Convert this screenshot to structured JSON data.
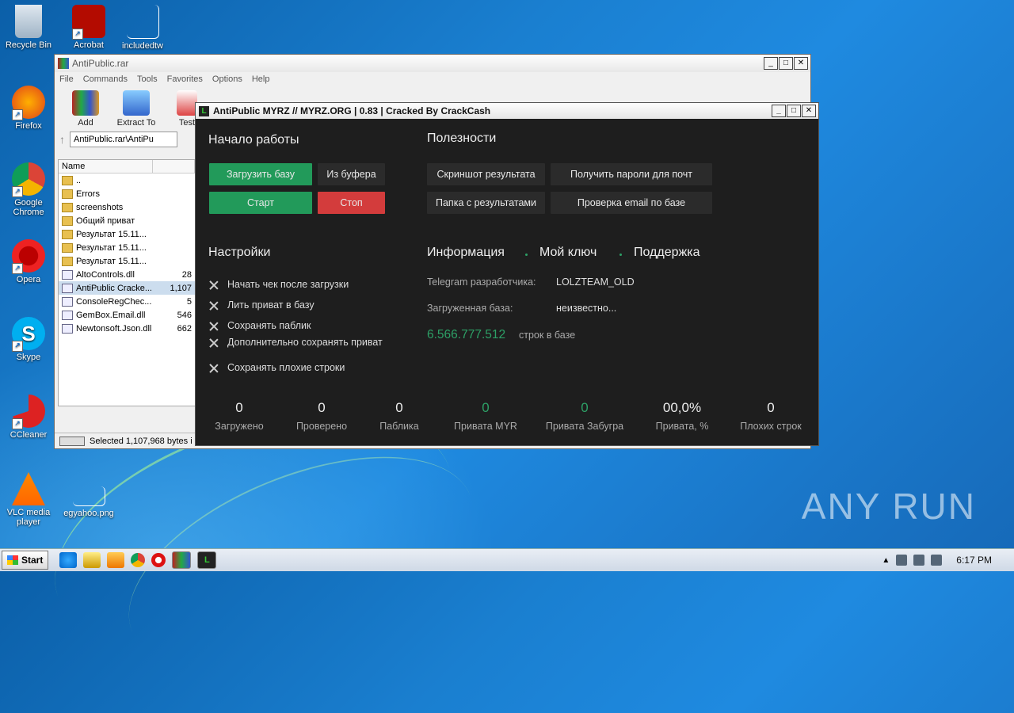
{
  "desktop": {
    "icons": [
      {
        "label": "Recycle Bin"
      },
      {
        "label": "Acrobat"
      },
      {
        "label": "includedtw"
      },
      {
        "label": "Firefox"
      },
      {
        "label": "Google Chrome"
      },
      {
        "label": "Opera"
      },
      {
        "label": "Skype"
      },
      {
        "label": "CCleaner"
      },
      {
        "label": "VLC media player"
      },
      {
        "label": "egyahoo.png"
      }
    ]
  },
  "winrar": {
    "title": "AntiPublic.rar",
    "menu": [
      "File",
      "Commands",
      "Tools",
      "Favorites",
      "Options",
      "Help"
    ],
    "toolbar": [
      "Add",
      "Extract To",
      "Test"
    ],
    "address": "AntiPublic.rar\\AntiPu",
    "column_name": "Name",
    "files": [
      {
        "name": "..",
        "size": ""
      },
      {
        "name": "Errors",
        "size": ""
      },
      {
        "name": "screenshots",
        "size": ""
      },
      {
        "name": "Общий приват",
        "size": ""
      },
      {
        "name": "Результат 15.11...",
        "size": ""
      },
      {
        "name": "Результат 15.11...",
        "size": ""
      },
      {
        "name": "Результат 15.11...",
        "size": ""
      },
      {
        "name": "AltoControls.dll",
        "size": "28"
      },
      {
        "name": "AntiPublic Cracke...",
        "size": "1,107"
      },
      {
        "name": "ConsoleRegChec...",
        "size": "5"
      },
      {
        "name": "GemBox.Email.dll",
        "size": "546"
      },
      {
        "name": "Newtonsoft.Json.dll",
        "size": "662"
      }
    ],
    "status": "Selected 1,107,968 bytes i"
  },
  "antipublic": {
    "title": "AntiPublic MYRZ // MYRZ.ORG | 0.83 | Cracked By CrackCash",
    "start_section": {
      "heading": "Начало работы",
      "load_db": "Загрузить базу",
      "from_buffer": "Из буфера",
      "start": "Старт",
      "stop": "Стоп"
    },
    "tools_section": {
      "heading": "Полезности",
      "screenshot": "Скриншот результата",
      "get_passwords": "Получить пароли для почт",
      "results_folder": "Папка с результатами",
      "check_email": "Проверка email по базе"
    },
    "settings": {
      "heading": "Настройки",
      "options": [
        "Начать чек после загрузки",
        "Лить приват в базу",
        "Сохранять паблик",
        "Дополнительно сохранять приват",
        "Сохранять плохие строки"
      ]
    },
    "info": {
      "tabs": [
        "Информация",
        "Мой ключ",
        "Поддержка"
      ],
      "telegram_label": "Telegram разработчика:",
      "telegram_value": "LOLZTEAM_OLD",
      "db_label": "Загруженная база:",
      "db_value": "неизвестно...",
      "count": "6.566.777.512",
      "count_label": "строк в базе"
    },
    "stats": [
      {
        "value": "0",
        "label": "Загружено"
      },
      {
        "value": "0",
        "label": "Проверено"
      },
      {
        "value": "0",
        "label": "Паблика"
      },
      {
        "value": "0",
        "label": "Привата MYR"
      },
      {
        "value": "0",
        "label": "Привата Забугра"
      },
      {
        "value": "00,0%",
        "label": "Привата, %"
      },
      {
        "value": "0",
        "label": "Плохих строк"
      }
    ],
    "accent_green": "#229a5a",
    "accent_red": "#d33c3c"
  },
  "taskbar": {
    "start": "Start",
    "clock": "6:17 PM"
  },
  "watermark": "ANY RUN"
}
